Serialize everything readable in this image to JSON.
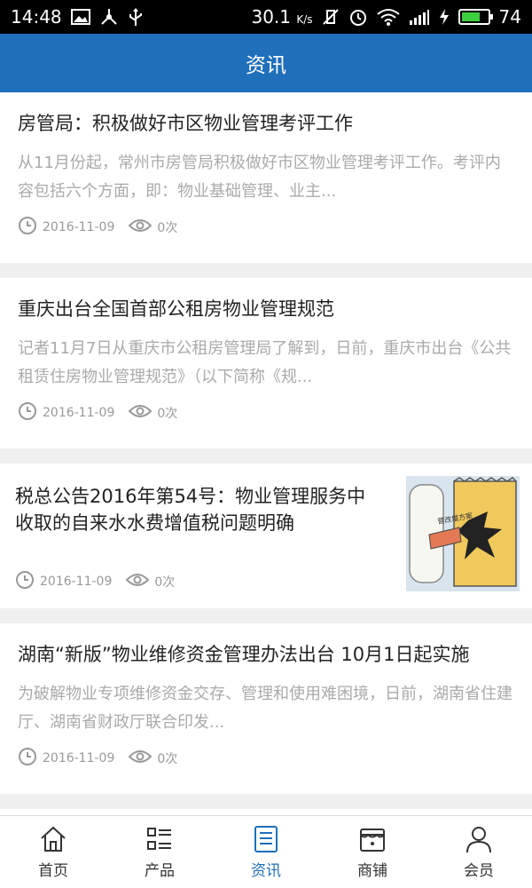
{
  "status_bar": {
    "time": "14:48",
    "speed": "30.1",
    "speed_unit": "K/s",
    "battery": "74",
    "battery_level": 0.74
  },
  "header": {
    "title": "资讯"
  },
  "articles": [
    {
      "title": "房管局：积极做好市区物业管理考评工作",
      "summary": "从11月份起，常州市房管局积极做好市区物业管理考评工作。考评内容包括六个方面，即：物业基础管理、业主...",
      "date": "2016-11-09",
      "views": "0次"
    },
    {
      "title": "重庆出台全国首部公租房物业管理规范",
      "summary": "记者11月7日从重庆市公租房管理局了解到，日前，重庆市出台《公共租赁住房物业管理规范》（以下简称《规...",
      "date": "2016-11-09",
      "views": "0次"
    },
    {
      "title": "税总公告2016年第54号：物业管理服务中收取的自来水水费增值税问题明确",
      "date": "2016-11-09",
      "views": "0次",
      "image_text": "营改增方案"
    },
    {
      "title": "湖南“新版”物业维修资金管理办法出台 10月1日起实施",
      "summary": "为破解物业专项维修资金交存、管理和使用难困境，日前，湖南省住建厅、湖南省财政厅联合印发...",
      "date": "2016-11-09",
      "views": "0次"
    }
  ],
  "tabs": [
    {
      "label": "首页",
      "icon": "home-icon"
    },
    {
      "label": "产品",
      "icon": "list-icon"
    },
    {
      "label": "资讯",
      "icon": "news-icon",
      "active": true
    },
    {
      "label": "商铺",
      "icon": "shop-icon"
    },
    {
      "label": "会员",
      "icon": "user-icon"
    }
  ],
  "colors": {
    "primary": "#1f6fba",
    "battery": "#3ecf3e"
  }
}
